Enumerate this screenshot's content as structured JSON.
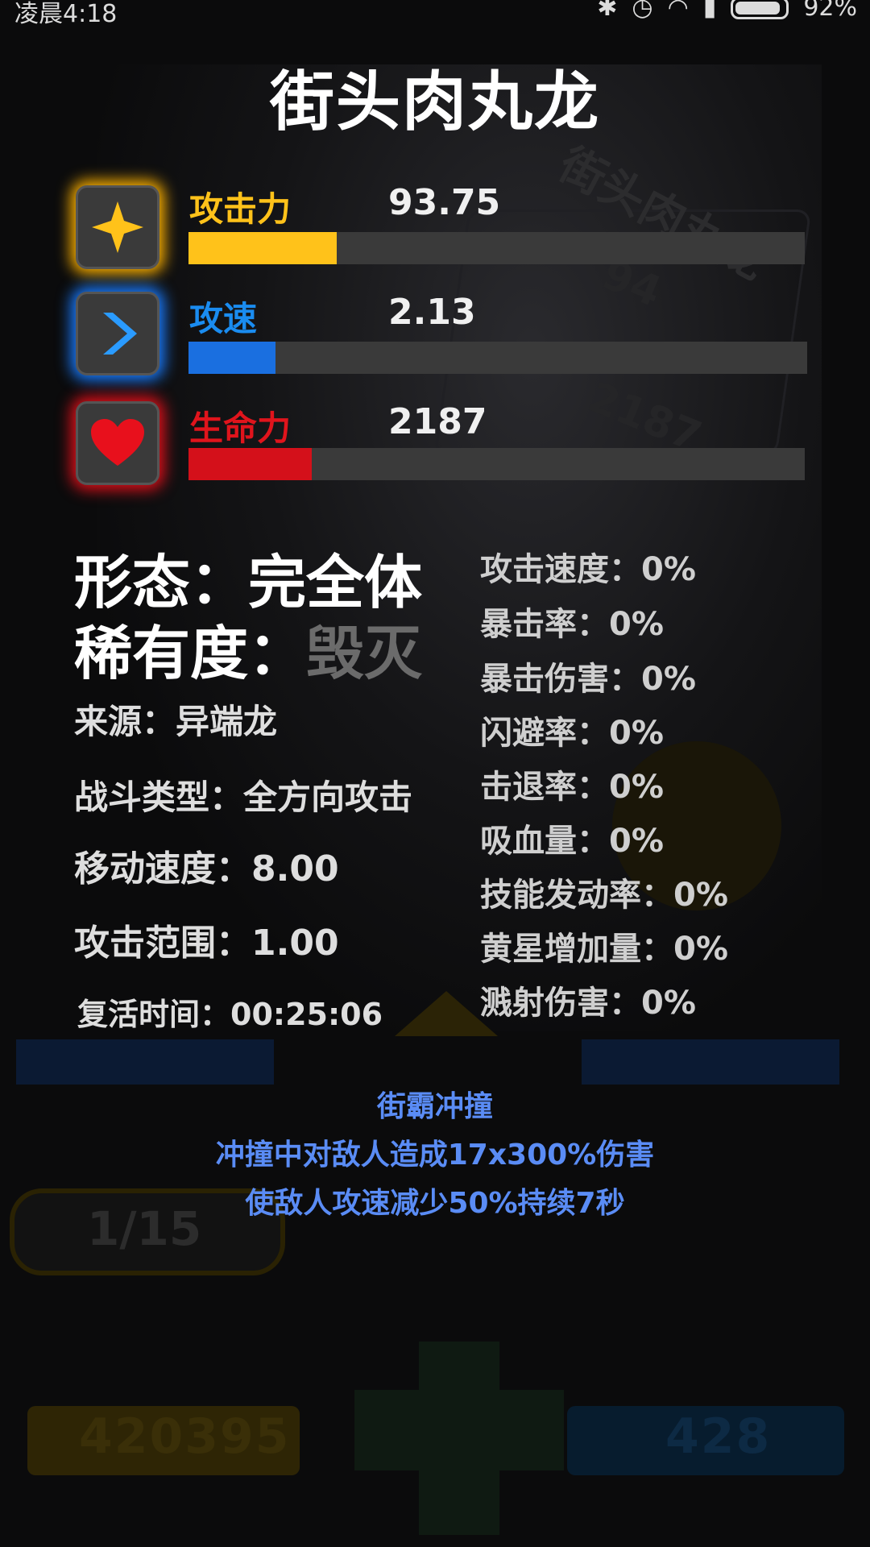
{
  "status_bar": {
    "time": "凌晨4:18",
    "battery": "92%"
  },
  "title": "街头肉丸龙",
  "stats": [
    {
      "label": "攻击力",
      "value": "93.75",
      "fill": 0.24,
      "color": "#ffc21a",
      "icon": "star-icon"
    },
    {
      "label": "攻速",
      "value": "2.13",
      "fill": 0.14,
      "color": "#1a6fe0",
      "icon": "chevron-right-icon"
    },
    {
      "label": "生命力",
      "value": "2187",
      "fill": 0.2,
      "color": "#d4101a",
      "icon": "heart-icon"
    }
  ],
  "info": {
    "form": "形态：完全体",
    "rarity_prefix": "稀有度：",
    "rarity_value": "毁灭",
    "source": "来源：异端龙",
    "combat_type": "战斗类型：全方向攻击",
    "move_speed": "移动速度：8.00",
    "attack_range": "攻击范围：1.00",
    "revive_time": "复活时间：00:25:06"
  },
  "attributes": [
    "攻击速度：0%",
    "暴击率：0%",
    "暴击伤害：0%",
    "闪避率：0%",
    "击退率：0%",
    "吸血量：0%",
    "技能发动率：0%",
    "黄星增加量：0%",
    "溅射伤害：0%"
  ],
  "skill": {
    "name": "街霸冲撞",
    "line1": "冲撞中对敌人造成17x300%伤害",
    "line2": "使敌人攻速减少50%持续7秒"
  },
  "background": {
    "ghost_title": "街头肉丸龙",
    "ghost_nums": [
      "94",
      "2187"
    ],
    "page": "1/15",
    "gold": "420395",
    "gems": "428"
  },
  "colors": {
    "attack": "#ffc21a",
    "speed": "#1a6fe0",
    "health": "#d4101a",
    "skill": "#5a8cf5",
    "rarity": "#6b6b6b"
  }
}
